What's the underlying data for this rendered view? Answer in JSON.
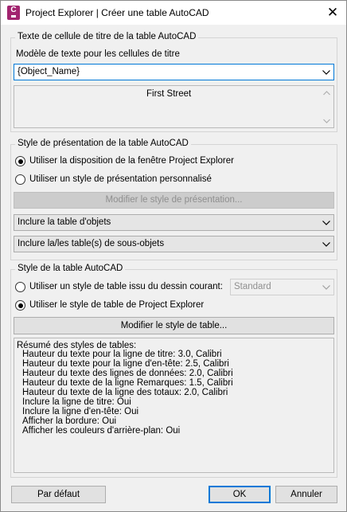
{
  "window": {
    "title": "Project Explorer | Créer une table AutoCAD"
  },
  "title_cell_group": {
    "legend": "Texte de cellule de titre de la table AutoCAD",
    "template_label": "Modèle de texte pour les cellules de titre",
    "template_value": "{Object_Name}",
    "preview_text": "First Street"
  },
  "layout_group": {
    "legend": "Style de présentation de la table AutoCAD",
    "radio_explorer": "Utiliser la disposition de la fenêtre Project Explorer",
    "radio_custom": "Utiliser un style de présentation personnalisé",
    "modify_layout_button": "Modifier le style de présentation...",
    "objects_combo": "Inclure la table d'objets",
    "subobjects_combo": "Inclure la/les table(s) de sous-objets"
  },
  "style_group": {
    "legend": "Style de la table AutoCAD",
    "radio_drawing": "Utiliser un style de table issu du dessin courant:",
    "drawing_style_value": "Standard",
    "radio_explorer_style": "Utiliser le style de table de Project Explorer",
    "modify_style_button": "Modifier le style de table...",
    "summary": [
      "Résumé des styles de tables:",
      "Hauteur du texte pour la ligne de titre: 3.0, Calibri",
      "Hauteur du texte pour la ligne d'en-tête: 2.5, Calibri",
      "Hauteur du texte des lignes de données: 2.0, Calibri",
      "Hauteur du texte de la ligne Remarques: 1.5, Calibri",
      "Hauteur du texte de la ligne des totaux: 2.0, Calibri",
      "Inclure la ligne de titre: Oui",
      "Inclure la ligne d'en-tête: Oui",
      "Afficher la bordure: Oui",
      "Afficher les couleurs d'arrière-plan: Oui"
    ]
  },
  "footer": {
    "default_button": "Par défaut",
    "ok_button": "OK",
    "cancel_button": "Annuler"
  },
  "colors": {
    "accent": "#0078d7",
    "app_icon": "#a2246f"
  }
}
